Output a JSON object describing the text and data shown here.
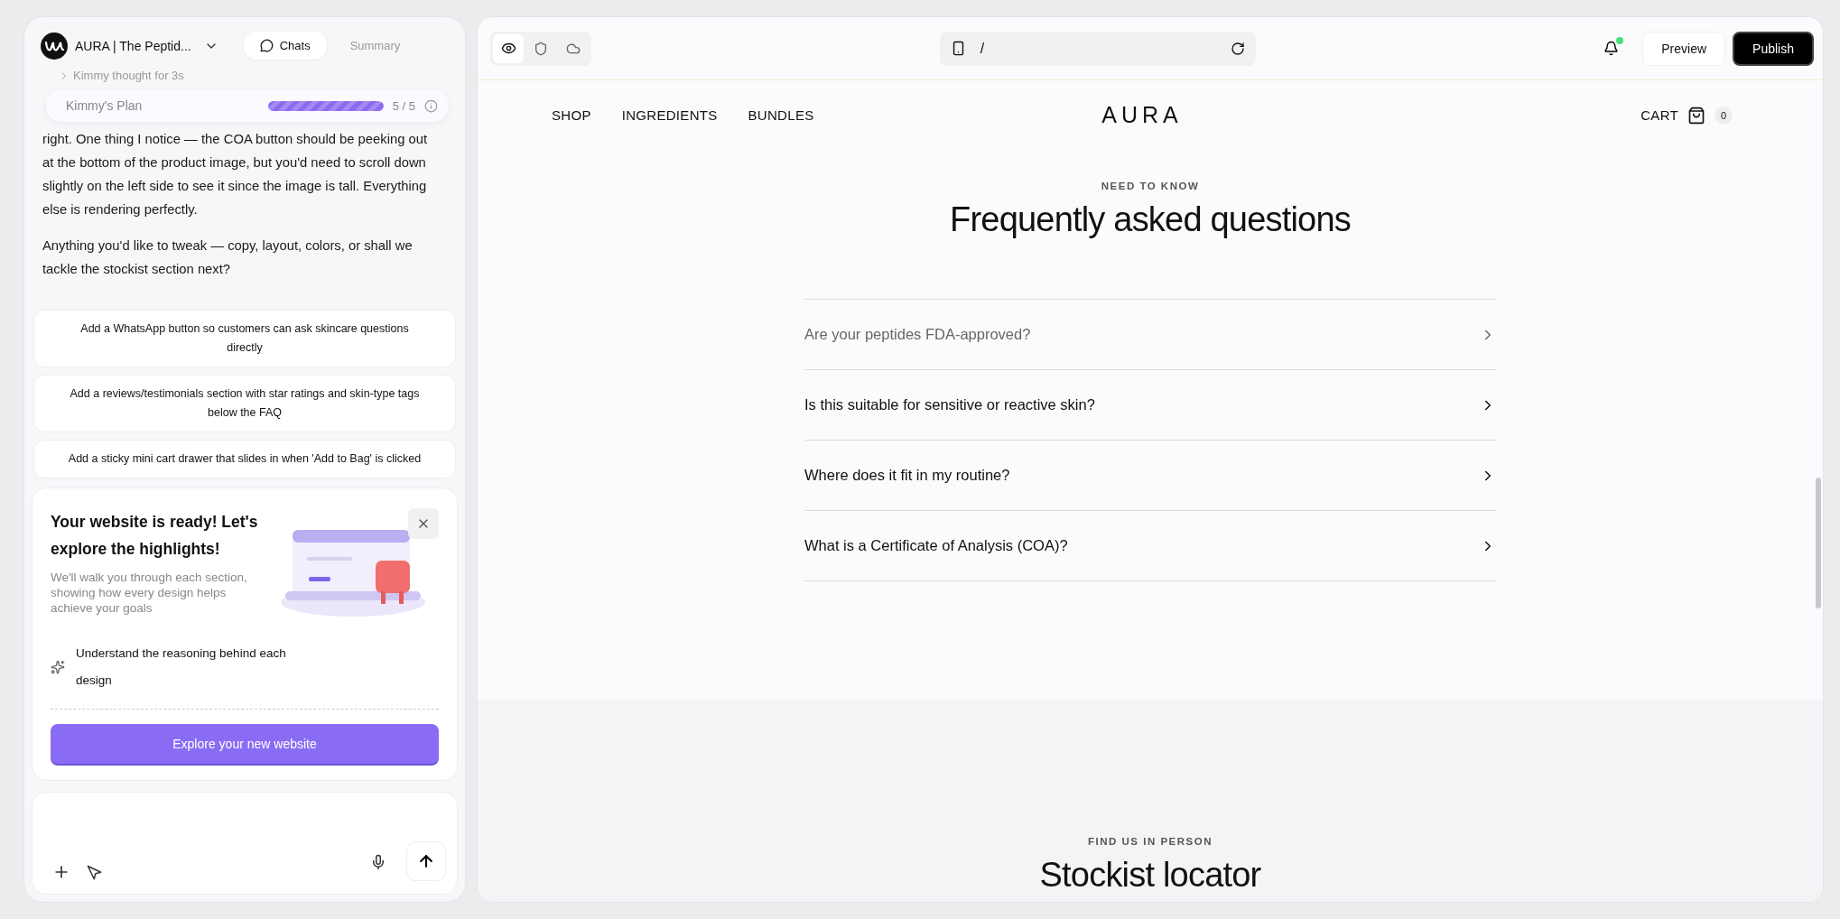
{
  "project": {
    "name": "AURA | The Peptid...",
    "tabs": [
      {
        "label": "Chats",
        "selected": true
      },
      {
        "label": "Summary",
        "selected": false
      }
    ]
  },
  "chat": {
    "thought": "Kimmy thought for 3s",
    "plan": {
      "title": "Kimmy's Plan",
      "level": 1,
      "count": "5 / 5"
    },
    "paragraphs": [
      "right. One thing I notice — the COA button should be peeking out at the bottom of the product image, but you'd need to scroll down slightly on the left side to see it since the image is tall. Everything else is rendering perfectly.",
      "Anything you'd like to tweak — copy, layout, colors, or shall we tackle the stockist section next?"
    ]
  },
  "suggestions": [
    "Add a WhatsApp button so customers can ask skincare questions directly",
    "Add a reviews/testimonials section with star ratings and skin-type tags below the FAQ",
    "Add a sticky mini cart drawer that slides in when 'Add to Bag' is clicked"
  ],
  "onboarding": {
    "title": "Your website is ready! Let's explore the highlights!",
    "description": "We'll walk you through each section, showing how every design helps achieve your goals",
    "feature": "Understand the reasoning behind each design",
    "button": "Explore your new website"
  },
  "toolbar": {
    "views": [
      {
        "kind": "eye",
        "selected": true
      },
      {
        "kind": "shield",
        "selected": false
      },
      {
        "kind": "cloud",
        "selected": false
      }
    ],
    "address": "/",
    "notification": {
      "unread": true
    },
    "buttons": [
      {
        "label": "Preview",
        "kind": "secondary"
      },
      {
        "label": "Publish",
        "kind": "primary"
      }
    ]
  },
  "site": {
    "nav": [
      "SHOP",
      "INGREDIENTS",
      "BUNDLES"
    ],
    "logo": "AURA",
    "cart": {
      "label": "CART",
      "count": "0"
    },
    "faq": {
      "eyebrow": "NEED TO KNOW",
      "title": "Frequently asked questions",
      "items": [
        {
          "question": "Are your peptides FDA-approved?",
          "hovered": true
        },
        {
          "question": "Is this suitable for sensitive or reactive skin?",
          "hovered": false
        },
        {
          "question": "Where does it fit in my routine?",
          "hovered": false
        },
        {
          "question": "What is a Certificate of Analysis (COA)?",
          "hovered": false
        }
      ]
    },
    "stockist": {
      "eyebrow": "FIND US IN PERSON",
      "title": "Stockist locator"
    }
  }
}
